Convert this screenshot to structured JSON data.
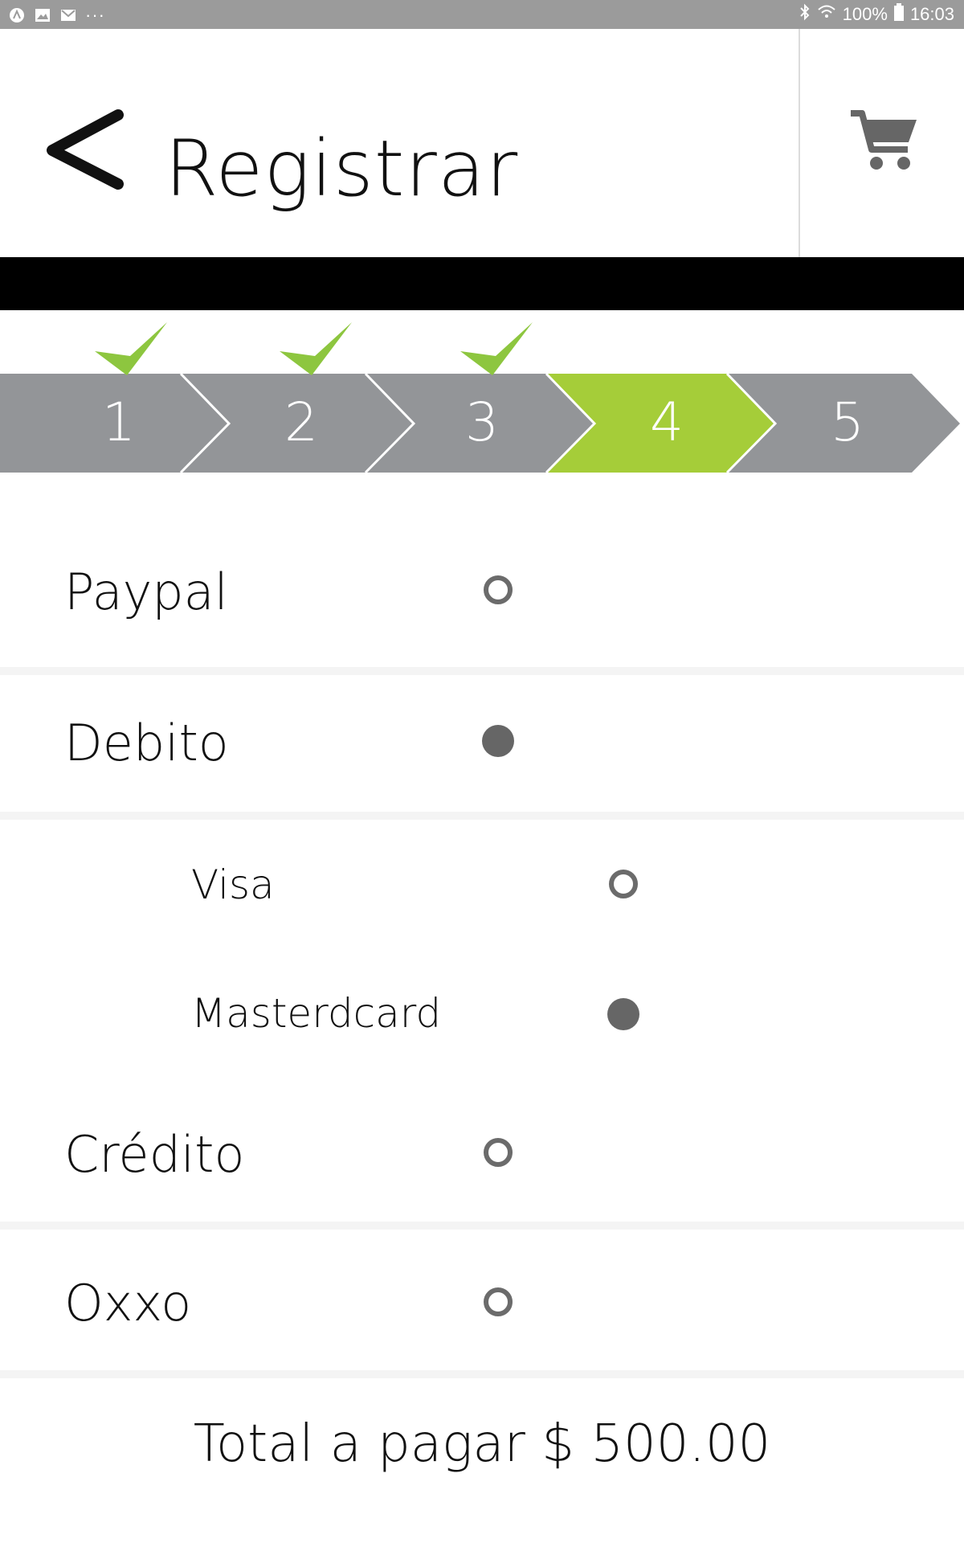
{
  "status_bar": {
    "left_icons": [
      "app-icon",
      "gallery-icon",
      "gmail-icon",
      "more-dots-icon"
    ],
    "more_text": "···",
    "battery": "100%",
    "time": "16:03"
  },
  "header": {
    "title": "Registrar",
    "back_icon": "chevron-left-icon",
    "cart_icon": "cart-icon"
  },
  "stepper": {
    "steps": [
      {
        "label": "1",
        "completed": true
      },
      {
        "label": "2",
        "completed": true
      },
      {
        "label": "3",
        "completed": true
      },
      {
        "label": "4",
        "completed": false,
        "active": true
      },
      {
        "label": "5",
        "completed": false
      }
    ],
    "colors": {
      "inactive": "#939598",
      "active": "#a5cd39",
      "check": "#8dc63f"
    }
  },
  "payment_options": [
    {
      "label": "Paypal",
      "selected": false
    },
    {
      "label": "Debito",
      "selected": true,
      "sub_options": [
        {
          "label": "Visa",
          "selected": false
        },
        {
          "label": "Masterdcard",
          "selected": true
        }
      ]
    },
    {
      "label": "Crédito",
      "selected": false
    },
    {
      "label": "Oxxo",
      "selected": false
    }
  ],
  "total": {
    "text": "Total a pagar $ 500.00"
  }
}
